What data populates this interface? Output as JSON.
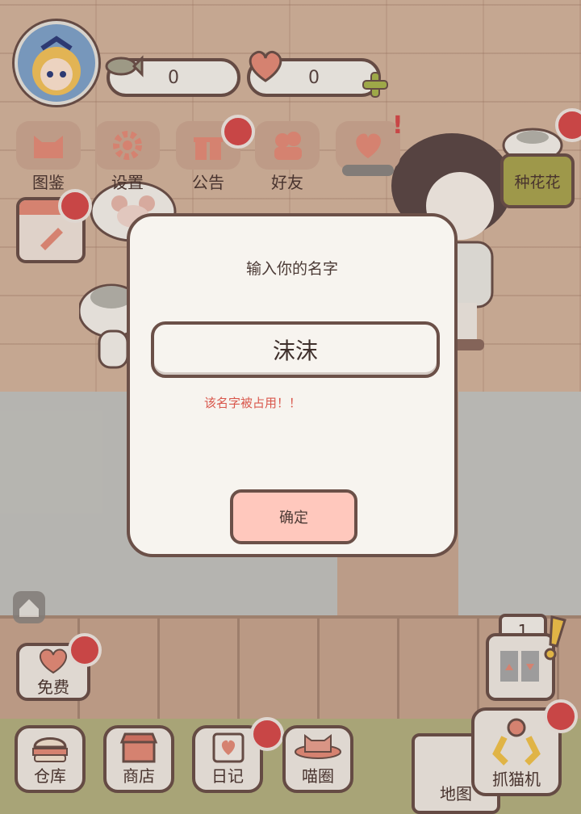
{
  "counters": {
    "fish": "0",
    "heart": "0"
  },
  "top_menu": [
    {
      "label": "图鉴",
      "icon": "cat-head-icon"
    },
    {
      "label": "设置",
      "icon": "gear-icon"
    },
    {
      "label": "公告",
      "icon": "gift-icon"
    },
    {
      "label": "好友",
      "icon": "friends-icon"
    }
  ],
  "plant_button": {
    "label": "种花花"
  },
  "dialog": {
    "title": "输入你的名字",
    "name_value": "沫沫",
    "error": "该名字被占用！！",
    "confirm_label": "确定"
  },
  "free_button": {
    "label": "免费"
  },
  "bottom_menu": [
    {
      "label": "仓库",
      "icon": "burger-icon"
    },
    {
      "label": "商店",
      "icon": "shop-icon"
    },
    {
      "label": "日记",
      "icon": "diary-icon"
    },
    {
      "label": "喵圈",
      "icon": "cat-planet-icon"
    }
  ],
  "map_button": {
    "label": "地图"
  },
  "claw_button": {
    "label": "抓猫机"
  },
  "elevator": {
    "floor": "1"
  },
  "colors": {
    "accent": "#d64a4a",
    "outline": "#6b5048",
    "confirm_bg": "#ffc8bd",
    "error": "#d9574c"
  }
}
